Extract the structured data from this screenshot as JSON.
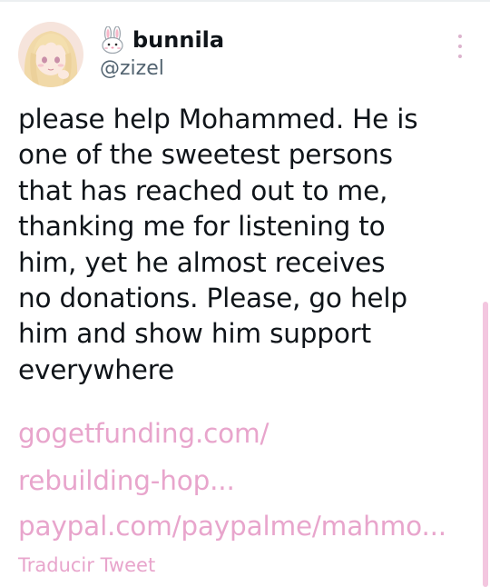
{
  "tweet": {
    "author": {
      "emoji_icon": "rabbit-face-icon",
      "display_name": "bunnila",
      "handle": "@zizel"
    },
    "more_icon": "more-vertical-icon",
    "text_lines": [
      "please help Mohammed. He is",
      "one of the sweetest persons",
      "that has reached out to me,",
      "thanking me for listening to",
      "him, yet he almost receives",
      "no donations. Please, go help",
      "him and show him support",
      "everywhere"
    ],
    "links": [
      {
        "line1": "gogetfunding.com/",
        "line2": "rebuilding-hop..."
      },
      {
        "line1": "paypal.com/paypalme/mahmo..."
      }
    ],
    "translate_label": "Traducir Tweet"
  },
  "colors": {
    "link": "#e8a5cc",
    "text": "#0f1419",
    "handle": "#536471",
    "scrollbar": "#f3c6df"
  }
}
